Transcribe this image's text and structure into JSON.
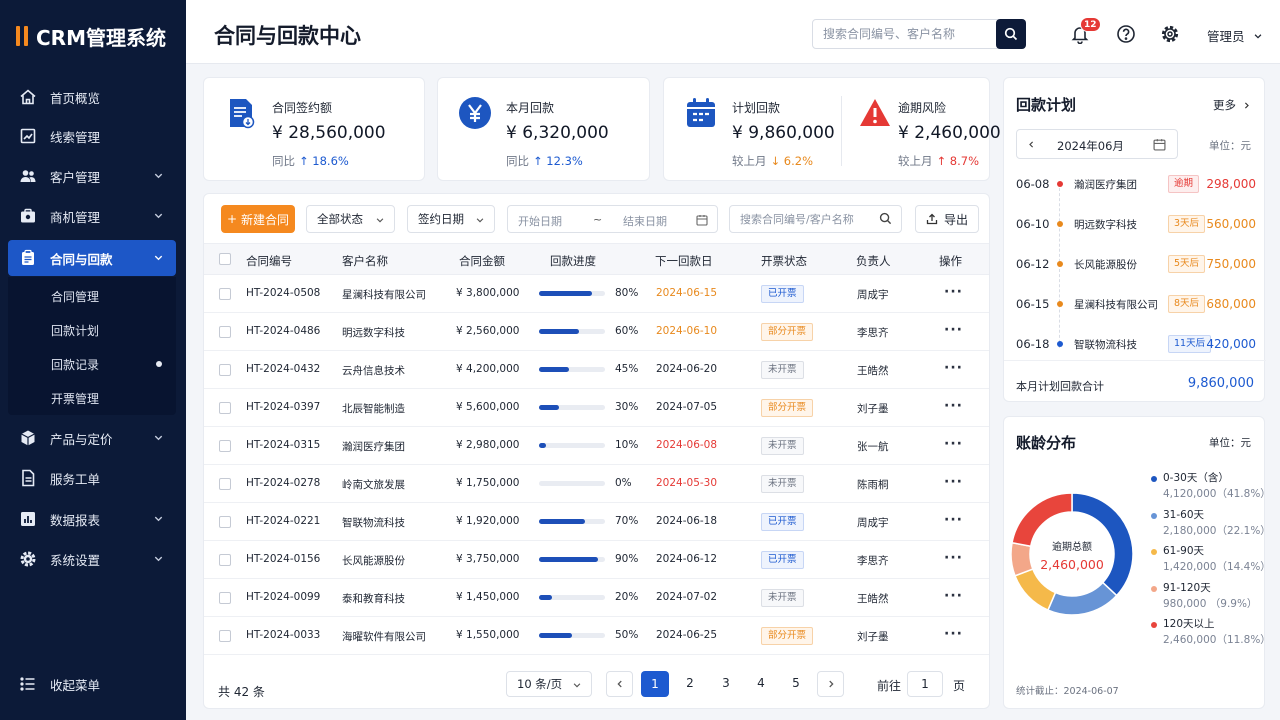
{
  "app": {
    "name": "CRM管理系统"
  },
  "sidebar": {
    "items": [
      {
        "label": "首页概览",
        "icon": "home-icon"
      },
      {
        "label": "线索管理",
        "icon": "chart-line-icon"
      },
      {
        "label": "客户管理",
        "icon": "users-icon"
      },
      {
        "label": "商机管理",
        "icon": "briefcase-icon"
      },
      {
        "label": "合同与回款",
        "icon": "clipboard-icon"
      },
      {
        "label": "产品与定价",
        "icon": "box-icon"
      },
      {
        "label": "服务工单",
        "icon": "document-icon"
      },
      {
        "label": "数据报表",
        "icon": "bar-chart-icon"
      },
      {
        "label": "系统设置",
        "icon": "gear-icon"
      }
    ],
    "submenu": [
      "合同管理",
      "回款计划",
      "回款记录",
      "开票管理"
    ],
    "collapse_label": "收起菜单"
  },
  "header": {
    "title": "合同与回款中心",
    "search_placeholder": "搜索合同编号、客户名称",
    "notification_count": "12",
    "user": "管理员"
  },
  "stats": [
    {
      "label": "合同签约额",
      "value": "¥ 28,560,000",
      "trend_label": "同比",
      "trend": "18.6%",
      "trend_dir": "up",
      "trend_color": "#1d5ad0",
      "icon": "contract-document-icon"
    },
    {
      "label": "本月回款",
      "value": "¥ 6,320,000",
      "trend_label": "同比",
      "trend": "12.3%",
      "trend_dir": "up",
      "trend_color": "#1d5ad0",
      "icon": "yen-icon"
    },
    {
      "label": "计划回款",
      "value": "¥ 9,860,000",
      "trend_label": "较上月",
      "trend": "6.2%",
      "trend_dir": "down",
      "trend_color": "#e8891d",
      "icon": "calendar-icon"
    },
    {
      "label": "逾期风险",
      "value": "¥ 2,460,000",
      "trend_label": "较上月",
      "trend": "8.7%",
      "trend_dir": "up",
      "trend_color": "#e53935",
      "icon": "warning-icon"
    }
  ],
  "toolbar": {
    "new_button": "新建合同",
    "status_filter": "全部状态",
    "date_type": "签约日期",
    "start_placeholder": "开始日期",
    "date_separator": "~",
    "end_placeholder": "结束日期",
    "search_placeholder": "搜索合同编号/客户名称",
    "export_button": "导出"
  },
  "table": {
    "columns": [
      "合同编号",
      "客户名称",
      "合同金额",
      "回款进度",
      "下一回款日",
      "开票状态",
      "负责人",
      "操作"
    ],
    "rows": [
      {
        "id": "HT-2024-0508",
        "customer": "星澜科技有限公司",
        "amount": "¥ 3,800,000",
        "progress": 80,
        "progress_label": "80%",
        "next_date": "2024-06-15",
        "date_color": "#e8891d",
        "invoice": "已开票",
        "owner": "周成宇"
      },
      {
        "id": "HT-2024-0486",
        "customer": "明远数字科技",
        "amount": "¥ 2,560,000",
        "progress": 60,
        "progress_label": "60%",
        "next_date": "2024-06-10",
        "date_color": "#e8891d",
        "invoice": "部分开票",
        "owner": "李思齐"
      },
      {
        "id": "HT-2024-0432",
        "customer": "云舟信息技术",
        "amount": "¥ 4,200,000",
        "progress": 45,
        "progress_label": "45%",
        "next_date": "2024-06-20",
        "date_color": "#1f2633",
        "invoice": "未开票",
        "owner": "王皓然"
      },
      {
        "id": "HT-2024-0397",
        "customer": "北辰智能制造",
        "amount": "¥ 5,600,000",
        "progress": 30,
        "progress_label": "30%",
        "next_date": "2024-07-05",
        "date_color": "#1f2633",
        "invoice": "部分开票",
        "owner": "刘子墨"
      },
      {
        "id": "HT-2024-0315",
        "customer": "瀚润医疗集团",
        "amount": "¥ 2,980,000",
        "progress": 10,
        "progress_label": "10%",
        "next_date": "2024-06-08",
        "date_color": "#e53935",
        "invoice": "未开票",
        "owner": "张一航"
      },
      {
        "id": "HT-2024-0278",
        "customer": "岭南文旅发展",
        "amount": "¥ 1,750,000",
        "progress": 0,
        "progress_label": "0%",
        "next_date": "2024-05-30",
        "date_color": "#e53935",
        "invoice": "未开票",
        "owner": "陈雨桐"
      },
      {
        "id": "HT-2024-0221",
        "customer": "智联物流科技",
        "amount": "¥ 1,920,000",
        "progress": 70,
        "progress_label": "70%",
        "next_date": "2024-06-18",
        "date_color": "#1f2633",
        "invoice": "已开票",
        "owner": "周成宇"
      },
      {
        "id": "HT-2024-0156",
        "customer": "长风能源股份",
        "amount": "¥ 3,750,000",
        "progress": 90,
        "progress_label": "90%",
        "next_date": "2024-06-12",
        "date_color": "#1f2633",
        "invoice": "已开票",
        "owner": "李思齐"
      },
      {
        "id": "HT-2024-0099",
        "customer": "泰和教育科技",
        "amount": "¥ 1,450,000",
        "progress": 20,
        "progress_label": "20%",
        "next_date": "2024-07-02",
        "date_color": "#1f2633",
        "invoice": "未开票",
        "owner": "王皓然"
      },
      {
        "id": "HT-2024-0033",
        "customer": "海曜软件有限公司",
        "amount": "¥ 1,550,000",
        "progress": 50,
        "progress_label": "50%",
        "next_date": "2024-06-25",
        "date_color": "#1f2633",
        "invoice": "部分开票",
        "owner": "刘子墨"
      }
    ],
    "more_symbol": "···"
  },
  "invoice_styles": {
    "已开票": {
      "color": "#1d5ad0",
      "bg": "#eef3fd",
      "border": "#c7d6f5"
    },
    "部分开票": {
      "color": "#e8891d",
      "bg": "#fff5ea",
      "border": "#f7d2a8"
    },
    "未开票": {
      "color": "#6b7280",
      "bg": "#f7f8fa",
      "border": "#dcdfe5"
    }
  },
  "pagination": {
    "total": "共 42 条",
    "page_size": "10 条/页",
    "pages": [
      "1",
      "2",
      "3",
      "4",
      "5"
    ],
    "current": "1",
    "goto_label": "前往",
    "goto_value": "1",
    "goto_suffix": "页"
  },
  "plan": {
    "title": "回款计划",
    "more": "更多",
    "month": "2024年06月",
    "unit": "单位：元",
    "items": [
      {
        "date": "06-08",
        "customer": "瀚润医疗集团",
        "tag": "逾期",
        "amount": "298,000",
        "color": "#e53935",
        "bg": "#fdeeee",
        "border": "#f5c4c4"
      },
      {
        "date": "06-10",
        "customer": "明远数字科技",
        "tag": "3天后",
        "amount": "560,000",
        "color": "#e8891d",
        "bg": "#fff5ea",
        "border": "#f7d2a8"
      },
      {
        "date": "06-12",
        "customer": "长风能源股份",
        "tag": "5天后",
        "amount": "750,000",
        "color": "#e8891d",
        "bg": "#fff5ea",
        "border": "#f7d2a8"
      },
      {
        "date": "06-15",
        "customer": "星澜科技有限公司",
        "tag": "8天后",
        "amount": "680,000",
        "color": "#e8891d",
        "bg": "#fff5ea",
        "border": "#f7d2a8"
      },
      {
        "date": "06-18",
        "customer": "智联物流科技",
        "tag": "11天后",
        "amount": "420,000",
        "color": "#1d5ad0",
        "bg": "#eef3fd",
        "border": "#c7d6f5"
      }
    ],
    "total_label": "本月计划回款合计",
    "total_value": "9,860,000"
  },
  "aging": {
    "title": "账龄分布",
    "unit": "单位：元",
    "center_label": "逾期总额",
    "center_value": "2,460,000",
    "footer": "统计截止：2024-06-07"
  },
  "chart_data": {
    "type": "pie",
    "title": "账龄分布",
    "categories": [
      "0-30天（含）",
      "31-60天",
      "61-90天",
      "91-120天",
      "120天以上"
    ],
    "values": [
      4120000,
      2180000,
      1420000,
      980000,
      2460000
    ],
    "value_labels": [
      "4,120,000（41.8%）",
      "2,180,000（22.1%）",
      "1,420,000（14.4%）",
      "980,000 （9.9%）",
      "2,460,000（11.8%）"
    ],
    "colors": [
      "#1d56c0",
      "#6794d6",
      "#f5b94a",
      "#f3a789",
      "#e8453c"
    ],
    "legend": "right"
  }
}
